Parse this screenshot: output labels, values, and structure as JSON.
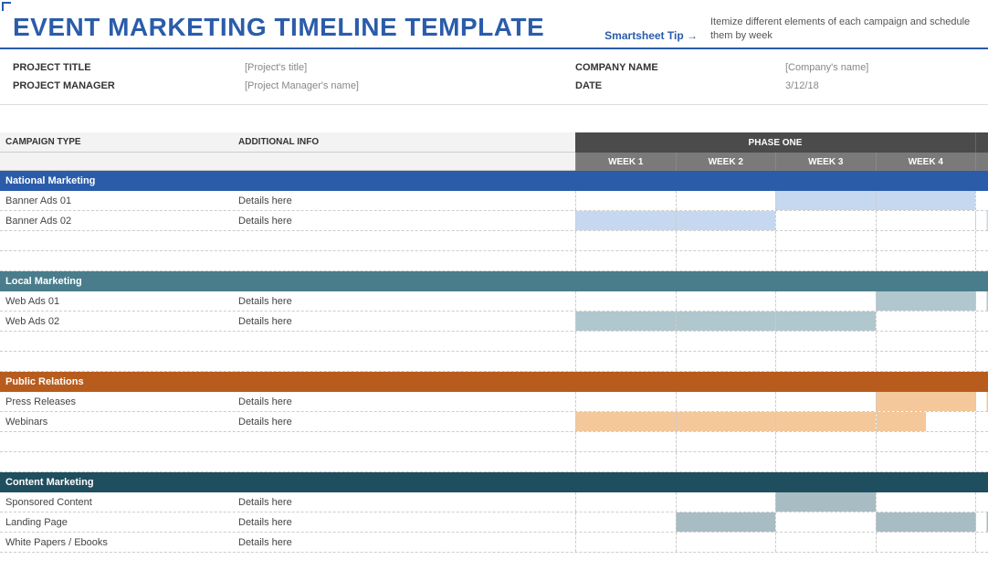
{
  "header": {
    "title": "EVENT MARKETING TIMELINE TEMPLATE",
    "tip_label": "Smartsheet Tip",
    "tip_arrow": "→",
    "tip_text": "Itemize different elements of each campaign and schedule them by week"
  },
  "meta": {
    "project_title_label": "PROJECT TITLE",
    "project_title_value": "[Project's title]",
    "project_manager_label": "PROJECT MANAGER",
    "project_manager_value": "[Project Manager's name]",
    "company_name_label": "COMPANY NAME",
    "company_name_value": "[Company's name]",
    "date_label": "DATE",
    "date_value": "3/12/18"
  },
  "columns": {
    "campaign_type": "CAMPAIGN TYPE",
    "additional_info": "ADDITIONAL INFO",
    "phase_one": "PHASE ONE",
    "weeks": [
      "WEEK 1",
      "WEEK 2",
      "WEEK 3",
      "WEEK 4"
    ]
  },
  "categories": {
    "national": "National Marketing",
    "local": "Local Marketing",
    "pr": "Public Relations",
    "content": "Content Marketing"
  },
  "rows": {
    "banner1": {
      "name": "Banner Ads 01",
      "info": "Details here"
    },
    "banner2": {
      "name": "Banner Ads 02",
      "info": "Details here"
    },
    "web1": {
      "name": "Web Ads 01",
      "info": "Details here"
    },
    "web2": {
      "name": "Web Ads 02",
      "info": "Details here"
    },
    "press": {
      "name": "Press Releases",
      "info": "Details here"
    },
    "webinars": {
      "name": "Webinars",
      "info": "Details here"
    },
    "sponsored": {
      "name": "Sponsored Content",
      "info": "Details here"
    },
    "landing": {
      "name": "Landing Page",
      "info": "Details here"
    },
    "white": {
      "name": "White Papers / Ebooks",
      "info": "Details here"
    }
  }
}
